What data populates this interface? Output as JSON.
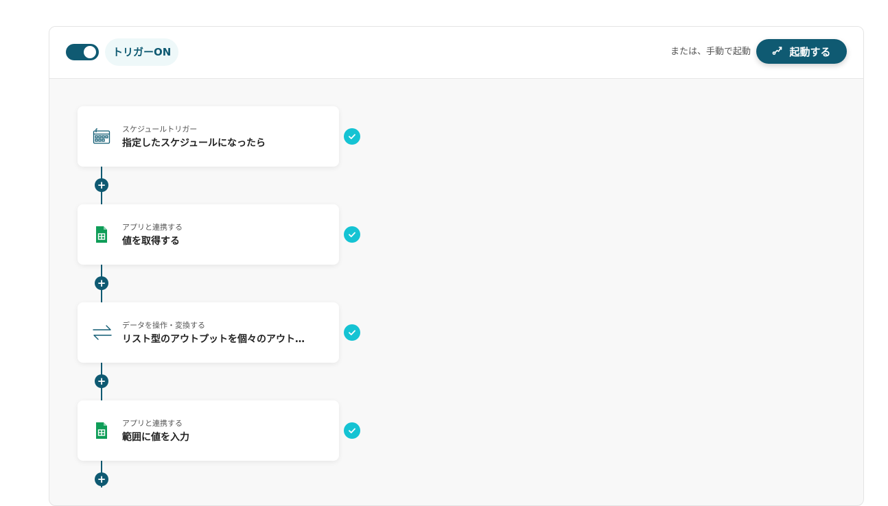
{
  "header": {
    "trigger_label": "トリガーON",
    "manual_label": "または、手動で起動",
    "start_button_label": "起動する"
  },
  "colors": {
    "primary": "#0f5a72",
    "check": "#15c3d3",
    "sheets_green": "#0f9d58",
    "background": "#f8f8f8"
  },
  "steps": [
    {
      "icon": "calendar-icon",
      "subtitle": "スケジュールトリガー",
      "title": "指定したスケジュールになったら",
      "status": "completed"
    },
    {
      "icon": "google-sheets-icon",
      "subtitle": "アプリと連携する",
      "title": "値を取得する",
      "status": "completed"
    },
    {
      "icon": "transform-arrows-icon",
      "subtitle": "データを操作・変換する",
      "title": "リスト型のアウトプットを個々のアウトプットに変換する",
      "status": "completed"
    },
    {
      "icon": "google-sheets-icon",
      "subtitle": "アプリと連携する",
      "title": "範囲に値を入力",
      "status": "completed"
    }
  ],
  "add_step_symbol": "+"
}
